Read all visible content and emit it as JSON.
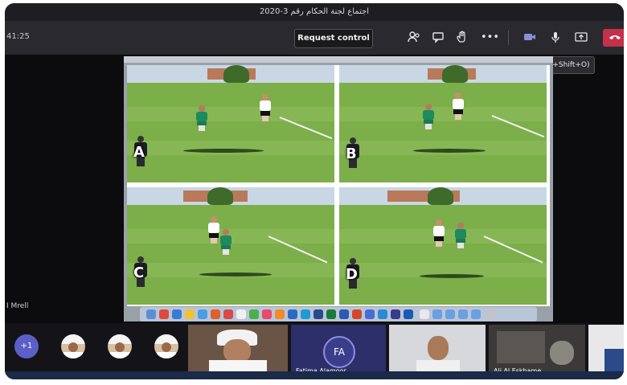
{
  "window": {
    "title": "اجتماع لجنة الحكام رقم 3-2020"
  },
  "meeting": {
    "timer": "41:25"
  },
  "toolbar": {
    "request_control_label": "Request control",
    "icons": [
      "people-icon",
      "chat-icon",
      "raise-hand-icon",
      "more-options-icon",
      "camera-icon",
      "microphone-icon",
      "share-screen-icon",
      "hang-up-icon"
    ],
    "more_glyph": "•••",
    "hangup_color": "#c4314b"
  },
  "tooltip": {
    "text": "Turn camera off (Ctrl+Shift+O)"
  },
  "shared_screen": {
    "panels": [
      {
        "label": "A"
      },
      {
        "label": "B"
      },
      {
        "label": "C"
      },
      {
        "label": "D"
      }
    ],
    "presenter": "I Mrell"
  },
  "participants": {
    "overflow_label": "+1",
    "initials_label": "FA",
    "tiles": [
      {
        "name": "Fatima Alamoor"
      },
      {
        "name": "Ali Al Eskhame"
      }
    ]
  },
  "colors": {
    "accent": "#5b5fc7",
    "grass": "#7cae4a",
    "home_kit": "#ffffff",
    "away_kit": "#1e8a5e"
  }
}
